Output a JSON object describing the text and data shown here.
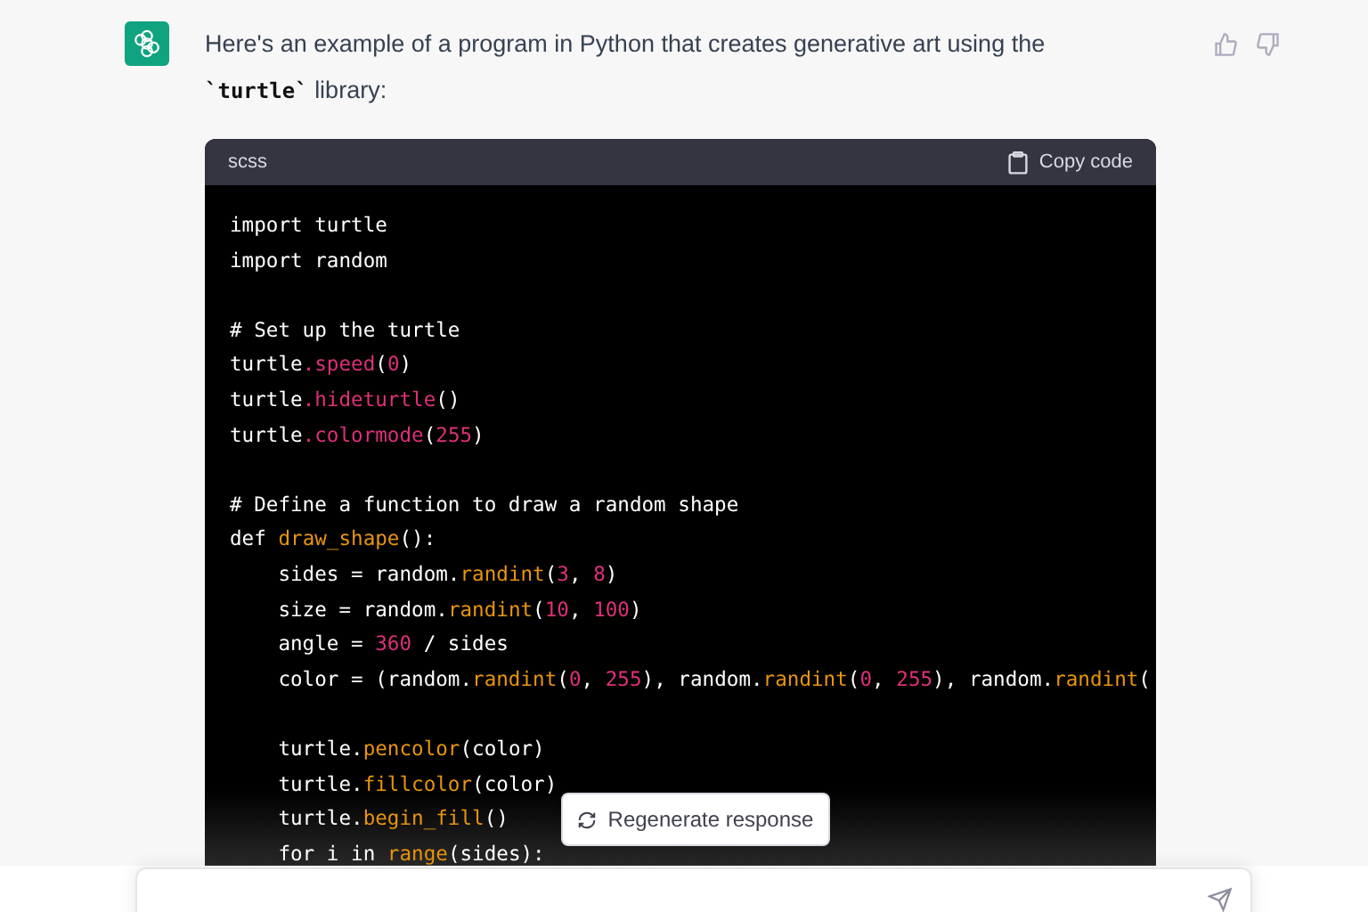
{
  "message": {
    "text": "Here's an example of a program in Python that creates generative art using the",
    "code_word": "`turtle`",
    "text_end": "library:"
  },
  "code_block": {
    "language": "scss",
    "copy_label": "Copy code",
    "lines": [
      {
        "kind": "code",
        "tokens": [
          {
            "t": "import turtle",
            "kind": "plain"
          }
        ]
      },
      {
        "kind": "code",
        "tokens": [
          {
            "t": "import random",
            "kind": "plain"
          }
        ]
      },
      {
        "kind": "blank"
      },
      {
        "kind": "code",
        "tokens": [
          {
            "t": "# Set up the turtle",
            "kind": "plain"
          }
        ]
      },
      {
        "kind": "code",
        "tokens": [
          {
            "t": "turtle",
            "kind": "plain"
          },
          {
            "t": ".speed",
            "kind": "attr"
          },
          {
            "t": "(",
            "kind": "plain"
          },
          {
            "t": "0",
            "kind": "num"
          },
          {
            "t": ")",
            "kind": "plain"
          }
        ]
      },
      {
        "kind": "code",
        "tokens": [
          {
            "t": "turtle",
            "kind": "plain"
          },
          {
            "t": ".hideturtle",
            "kind": "attr"
          },
          {
            "t": "()",
            "kind": "plain"
          }
        ]
      },
      {
        "kind": "code",
        "tokens": [
          {
            "t": "turtle",
            "kind": "plain"
          },
          {
            "t": ".colormode",
            "kind": "attr"
          },
          {
            "t": "(",
            "kind": "plain"
          },
          {
            "t": "255",
            "kind": "num"
          },
          {
            "t": ")",
            "kind": "plain"
          }
        ]
      },
      {
        "kind": "blank"
      },
      {
        "kind": "code",
        "tokens": [
          {
            "t": "# Define a function to draw a random shape",
            "kind": "plain"
          }
        ]
      },
      {
        "kind": "code",
        "tokens": [
          {
            "t": "def ",
            "kind": "plain"
          },
          {
            "t": "draw_shape",
            "kind": "call"
          },
          {
            "t": "():",
            "kind": "plain"
          }
        ]
      },
      {
        "kind": "code",
        "tokens": [
          {
            "t": "    sides = random.",
            "kind": "plain"
          },
          {
            "t": "randint",
            "kind": "call"
          },
          {
            "t": "(",
            "kind": "plain"
          },
          {
            "t": "3",
            "kind": "num"
          },
          {
            "t": ", ",
            "kind": "plain"
          },
          {
            "t": "8",
            "kind": "num"
          },
          {
            "t": ")",
            "kind": "plain"
          }
        ]
      },
      {
        "kind": "code",
        "tokens": [
          {
            "t": "    size = random.",
            "kind": "plain"
          },
          {
            "t": "randint",
            "kind": "call"
          },
          {
            "t": "(",
            "kind": "plain"
          },
          {
            "t": "10",
            "kind": "num"
          },
          {
            "t": ", ",
            "kind": "plain"
          },
          {
            "t": "100",
            "kind": "num"
          },
          {
            "t": ")",
            "kind": "plain"
          }
        ]
      },
      {
        "kind": "code",
        "tokens": [
          {
            "t": "    angle = ",
            "kind": "plain"
          },
          {
            "t": "360",
            "kind": "num"
          },
          {
            "t": " / sides",
            "kind": "plain"
          }
        ]
      },
      {
        "kind": "code",
        "tokens": [
          {
            "t": "    color = (random.",
            "kind": "plain"
          },
          {
            "t": "randint",
            "kind": "call"
          },
          {
            "t": "(",
            "kind": "plain"
          },
          {
            "t": "0",
            "kind": "num"
          },
          {
            "t": ", ",
            "kind": "plain"
          },
          {
            "t": "255",
            "kind": "num"
          },
          {
            "t": "), random.",
            "kind": "plain"
          },
          {
            "t": "randint",
            "kind": "call"
          },
          {
            "t": "(",
            "kind": "plain"
          },
          {
            "t": "0",
            "kind": "num"
          },
          {
            "t": ", ",
            "kind": "plain"
          },
          {
            "t": "255",
            "kind": "num"
          },
          {
            "t": "), random.",
            "kind": "plain"
          },
          {
            "t": "randint",
            "kind": "call"
          },
          {
            "t": "(",
            "kind": "plain"
          }
        ]
      },
      {
        "kind": "blank"
      },
      {
        "kind": "code",
        "tokens": [
          {
            "t": "    turtle.",
            "kind": "plain"
          },
          {
            "t": "pencolor",
            "kind": "call"
          },
          {
            "t": "(color)",
            "kind": "plain"
          }
        ]
      },
      {
        "kind": "code",
        "tokens": [
          {
            "t": "    turtle.",
            "kind": "plain"
          },
          {
            "t": "fillcolor",
            "kind": "call"
          },
          {
            "t": "(color)",
            "kind": "plain"
          }
        ]
      },
      {
        "kind": "code",
        "tokens": [
          {
            "t": "    turtle.",
            "kind": "plain"
          },
          {
            "t": "begin_fill",
            "kind": "call"
          },
          {
            "t": "()",
            "kind": "plain"
          }
        ]
      },
      {
        "kind": "code",
        "tokens": [
          {
            "t": "    for i in ",
            "kind": "plain"
          },
          {
            "t": "range",
            "kind": "call"
          },
          {
            "t": "(sides):",
            "kind": "plain"
          }
        ]
      }
    ]
  },
  "regenerate_button": {
    "label": "Regenerate response"
  }
}
